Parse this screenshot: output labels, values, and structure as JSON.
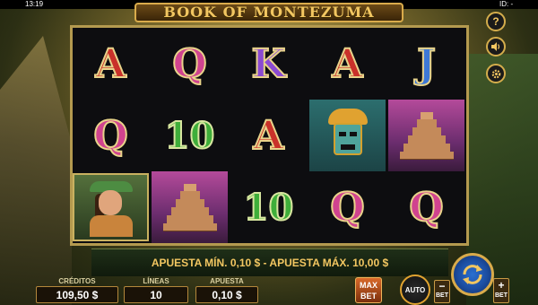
{
  "status": {
    "time": "13:19",
    "id_label": "ID: -"
  },
  "game": {
    "title": "BOOK OF MONTEZUMA"
  },
  "reels": [
    [
      "A",
      "Q",
      "explorer"
    ],
    [
      "Q",
      "10",
      "pyramid"
    ],
    [
      "K",
      "A",
      "10"
    ],
    [
      "A",
      "mask",
      "Q"
    ],
    [
      "J",
      "pyramid",
      "Q"
    ]
  ],
  "side_menu": {
    "help": "?",
    "sound_icon": "speaker-icon",
    "settings_icon": "gear-icon"
  },
  "info": {
    "message": "APUESTA MÍN. 0,10 $ - APUESTA MÁX. 10,00 $"
  },
  "panels": {
    "credits_label": "CRÉDITOS",
    "credits_value": "109,50 $",
    "lines_label": "LÍNEAS",
    "lines_value": "10",
    "bet_label": "APUESTA",
    "bet_value": "0,10 $"
  },
  "controls": {
    "max_line1": "MAX",
    "max_line2": "BET",
    "auto_label": "AUTO",
    "minus_sign": "−",
    "plus_sign": "+",
    "bet_label": "BET",
    "spin_icon": "spin-arrows-icon"
  },
  "colors": {
    "gold": "#d9ab4b",
    "spin_blue": "#2b6fd1"
  }
}
